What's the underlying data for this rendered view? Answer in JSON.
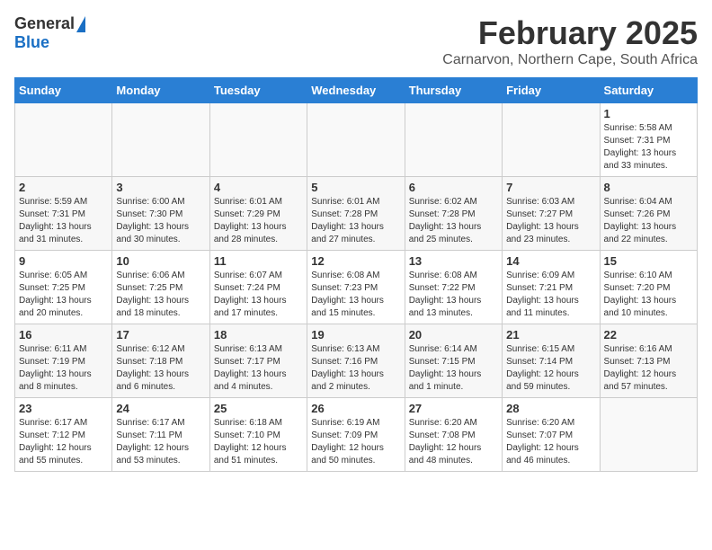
{
  "header": {
    "logo_general": "General",
    "logo_blue": "Blue",
    "month_title": "February 2025",
    "location": "Carnarvon, Northern Cape, South Africa"
  },
  "days_of_week": [
    "Sunday",
    "Monday",
    "Tuesday",
    "Wednesday",
    "Thursday",
    "Friday",
    "Saturday"
  ],
  "weeks": [
    [
      {
        "day": "",
        "info": ""
      },
      {
        "day": "",
        "info": ""
      },
      {
        "day": "",
        "info": ""
      },
      {
        "day": "",
        "info": ""
      },
      {
        "day": "",
        "info": ""
      },
      {
        "day": "",
        "info": ""
      },
      {
        "day": "1",
        "info": "Sunrise: 5:58 AM\nSunset: 7:31 PM\nDaylight: 13 hours\nand 33 minutes."
      }
    ],
    [
      {
        "day": "2",
        "info": "Sunrise: 5:59 AM\nSunset: 7:31 PM\nDaylight: 13 hours\nand 31 minutes."
      },
      {
        "day": "3",
        "info": "Sunrise: 6:00 AM\nSunset: 7:30 PM\nDaylight: 13 hours\nand 30 minutes."
      },
      {
        "day": "4",
        "info": "Sunrise: 6:01 AM\nSunset: 7:29 PM\nDaylight: 13 hours\nand 28 minutes."
      },
      {
        "day": "5",
        "info": "Sunrise: 6:01 AM\nSunset: 7:28 PM\nDaylight: 13 hours\nand 27 minutes."
      },
      {
        "day": "6",
        "info": "Sunrise: 6:02 AM\nSunset: 7:28 PM\nDaylight: 13 hours\nand 25 minutes."
      },
      {
        "day": "7",
        "info": "Sunrise: 6:03 AM\nSunset: 7:27 PM\nDaylight: 13 hours\nand 23 minutes."
      },
      {
        "day": "8",
        "info": "Sunrise: 6:04 AM\nSunset: 7:26 PM\nDaylight: 13 hours\nand 22 minutes."
      }
    ],
    [
      {
        "day": "9",
        "info": "Sunrise: 6:05 AM\nSunset: 7:25 PM\nDaylight: 13 hours\nand 20 minutes."
      },
      {
        "day": "10",
        "info": "Sunrise: 6:06 AM\nSunset: 7:25 PM\nDaylight: 13 hours\nand 18 minutes."
      },
      {
        "day": "11",
        "info": "Sunrise: 6:07 AM\nSunset: 7:24 PM\nDaylight: 13 hours\nand 17 minutes."
      },
      {
        "day": "12",
        "info": "Sunrise: 6:08 AM\nSunset: 7:23 PM\nDaylight: 13 hours\nand 15 minutes."
      },
      {
        "day": "13",
        "info": "Sunrise: 6:08 AM\nSunset: 7:22 PM\nDaylight: 13 hours\nand 13 minutes."
      },
      {
        "day": "14",
        "info": "Sunrise: 6:09 AM\nSunset: 7:21 PM\nDaylight: 13 hours\nand 11 minutes."
      },
      {
        "day": "15",
        "info": "Sunrise: 6:10 AM\nSunset: 7:20 PM\nDaylight: 13 hours\nand 10 minutes."
      }
    ],
    [
      {
        "day": "16",
        "info": "Sunrise: 6:11 AM\nSunset: 7:19 PM\nDaylight: 13 hours\nand 8 minutes."
      },
      {
        "day": "17",
        "info": "Sunrise: 6:12 AM\nSunset: 7:18 PM\nDaylight: 13 hours\nand 6 minutes."
      },
      {
        "day": "18",
        "info": "Sunrise: 6:13 AM\nSunset: 7:17 PM\nDaylight: 13 hours\nand 4 minutes."
      },
      {
        "day": "19",
        "info": "Sunrise: 6:13 AM\nSunset: 7:16 PM\nDaylight: 13 hours\nand 2 minutes."
      },
      {
        "day": "20",
        "info": "Sunrise: 6:14 AM\nSunset: 7:15 PM\nDaylight: 13 hours\nand 1 minute."
      },
      {
        "day": "21",
        "info": "Sunrise: 6:15 AM\nSunset: 7:14 PM\nDaylight: 12 hours\nand 59 minutes."
      },
      {
        "day": "22",
        "info": "Sunrise: 6:16 AM\nSunset: 7:13 PM\nDaylight: 12 hours\nand 57 minutes."
      }
    ],
    [
      {
        "day": "23",
        "info": "Sunrise: 6:17 AM\nSunset: 7:12 PM\nDaylight: 12 hours\nand 55 minutes."
      },
      {
        "day": "24",
        "info": "Sunrise: 6:17 AM\nSunset: 7:11 PM\nDaylight: 12 hours\nand 53 minutes."
      },
      {
        "day": "25",
        "info": "Sunrise: 6:18 AM\nSunset: 7:10 PM\nDaylight: 12 hours\nand 51 minutes."
      },
      {
        "day": "26",
        "info": "Sunrise: 6:19 AM\nSunset: 7:09 PM\nDaylight: 12 hours\nand 50 minutes."
      },
      {
        "day": "27",
        "info": "Sunrise: 6:20 AM\nSunset: 7:08 PM\nDaylight: 12 hours\nand 48 minutes."
      },
      {
        "day": "28",
        "info": "Sunrise: 6:20 AM\nSunset: 7:07 PM\nDaylight: 12 hours\nand 46 minutes."
      },
      {
        "day": "",
        "info": ""
      }
    ]
  ]
}
